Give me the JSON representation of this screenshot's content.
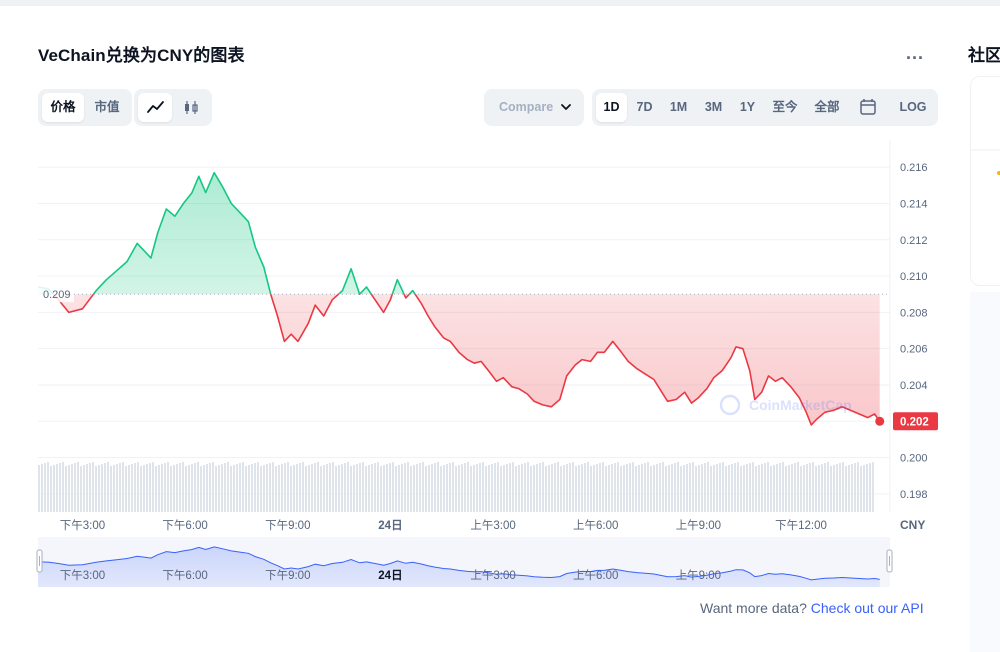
{
  "title": "VeChain兑换为CNY的图表",
  "more_label": "...",
  "side_title": "社区",
  "toggles": {
    "metric": [
      "价格",
      "市值"
    ],
    "chart_kinds": [
      "line-chart-icon",
      "candlestick-icon"
    ]
  },
  "compare_label": "Compare",
  "ranges": [
    "1D",
    "7D",
    "1M",
    "3M",
    "1Y",
    "至今",
    "全部"
  ],
  "calendar_icon": "calendar-icon",
  "log_label": "LOG",
  "colors": {
    "up": "#16c784",
    "down": "#ea3943",
    "brand": "#3861fb"
  },
  "watermark": "CoinMarketCap",
  "footer": {
    "text": "Want more data?",
    "link": "Check out our API"
  },
  "chart_data": {
    "type": "line",
    "currency": "CNY",
    "reference_value": 0.209,
    "reference_label": "0.209",
    "current_value": 0.202,
    "current_label": "0.202",
    "ylim": [
      0.197,
      0.2175
    ],
    "yticks": [
      "0.216",
      "0.214",
      "0.212",
      "0.210",
      "0.208",
      "0.206",
      "0.204",
      "0.202",
      "0.200",
      "0.198"
    ],
    "x_labels": [
      "下午3:00",
      "下午6:00",
      "下午9:00",
      "24日",
      "上午3:00",
      "上午6:00",
      "上午9:00",
      "下午12:00"
    ],
    "navigator_labels": [
      "下午3:00",
      "下午6:00",
      "下午9:00",
      "24日",
      "上午3:00",
      "上午6:00",
      "上午9:00"
    ],
    "xlim_hours": [
      13.7,
      36.6
    ],
    "series": [
      {
        "points": [
          [
            13.7,
            0.2094
          ],
          [
            14.0,
            0.2093
          ],
          [
            14.3,
            0.2087
          ],
          [
            14.6,
            0.208
          ],
          [
            15.0,
            0.2082
          ],
          [
            15.4,
            0.2092
          ],
          [
            15.7,
            0.2098
          ],
          [
            16.0,
            0.2103
          ],
          [
            16.3,
            0.2108
          ],
          [
            16.6,
            0.2118
          ],
          [
            16.8,
            0.2114
          ],
          [
            17.0,
            0.211
          ],
          [
            17.2,
            0.2124
          ],
          [
            17.45,
            0.2137
          ],
          [
            17.7,
            0.2133
          ],
          [
            17.95,
            0.214
          ],
          [
            18.2,
            0.2146
          ],
          [
            18.4,
            0.2155
          ],
          [
            18.6,
            0.2146
          ],
          [
            18.85,
            0.2157
          ],
          [
            19.1,
            0.2149
          ],
          [
            19.35,
            0.214
          ],
          [
            19.6,
            0.2135
          ],
          [
            19.85,
            0.213
          ],
          [
            20.05,
            0.2116
          ],
          [
            20.3,
            0.2105
          ],
          [
            20.5,
            0.209
          ],
          [
            20.7,
            0.2078
          ],
          [
            20.9,
            0.2064
          ],
          [
            21.1,
            0.2068
          ],
          [
            21.3,
            0.2064
          ],
          [
            21.6,
            0.2074
          ],
          [
            21.8,
            0.2084
          ],
          [
            22.05,
            0.2078
          ],
          [
            22.3,
            0.2087
          ],
          [
            22.6,
            0.2092
          ],
          [
            22.85,
            0.2104
          ],
          [
            23.1,
            0.209
          ],
          [
            23.3,
            0.2094
          ],
          [
            23.55,
            0.2087
          ],
          [
            23.8,
            0.208
          ],
          [
            24.0,
            0.2087
          ],
          [
            24.2,
            0.2098
          ],
          [
            24.45,
            0.2088
          ],
          [
            24.65,
            0.2092
          ],
          [
            24.9,
            0.2085
          ],
          [
            25.1,
            0.2078
          ],
          [
            25.3,
            0.2072
          ],
          [
            25.55,
            0.2066
          ],
          [
            25.75,
            0.2064
          ],
          [
            26.0,
            0.2058
          ],
          [
            26.25,
            0.2054
          ],
          [
            26.45,
            0.2052
          ],
          [
            26.65,
            0.2053
          ],
          [
            26.9,
            0.2047
          ],
          [
            27.1,
            0.2042
          ],
          [
            27.3,
            0.2044
          ],
          [
            27.55,
            0.2039
          ],
          [
            27.75,
            0.2038
          ],
          [
            28.0,
            0.2035
          ],
          [
            28.2,
            0.2031
          ],
          [
            28.45,
            0.2029
          ],
          [
            28.7,
            0.2028
          ],
          [
            28.95,
            0.2032
          ],
          [
            29.15,
            0.2045
          ],
          [
            29.4,
            0.2051
          ],
          [
            29.6,
            0.2054
          ],
          [
            29.85,
            0.2053
          ],
          [
            30.05,
            0.2058
          ],
          [
            30.25,
            0.2058
          ],
          [
            30.5,
            0.2064
          ],
          [
            30.75,
            0.2058
          ],
          [
            30.95,
            0.2053
          ],
          [
            31.2,
            0.2049
          ],
          [
            31.45,
            0.2046
          ],
          [
            31.7,
            0.2043
          ],
          [
            31.9,
            0.2037
          ],
          [
            32.1,
            0.2031
          ],
          [
            32.35,
            0.2032
          ],
          [
            32.6,
            0.2036
          ],
          [
            32.8,
            0.203
          ],
          [
            33.0,
            0.2033
          ],
          [
            33.25,
            0.2038
          ],
          [
            33.45,
            0.2044
          ],
          [
            33.7,
            0.2048
          ],
          [
            33.95,
            0.2055
          ],
          [
            34.1,
            0.2061
          ],
          [
            34.3,
            0.206
          ],
          [
            34.5,
            0.2048
          ],
          [
            34.65,
            0.2032
          ],
          [
            34.85,
            0.2036
          ],
          [
            35.05,
            0.2045
          ],
          [
            35.25,
            0.2042
          ],
          [
            35.45,
            0.2044
          ],
          [
            35.7,
            0.2039
          ],
          [
            35.95,
            0.2033
          ],
          [
            36.15,
            0.2025
          ],
          [
            36.3,
            0.2018
          ],
          [
            36.45,
            0.2021
          ],
          [
            36.7,
            0.2025
          ],
          [
            36.95,
            0.2026
          ],
          [
            37.2,
            0.2028
          ],
          [
            37.45,
            0.2026
          ],
          [
            37.7,
            0.2024
          ],
          [
            37.95,
            0.2022
          ],
          [
            38.15,
            0.2024
          ],
          [
            38.3,
            0.202
          ]
        ]
      }
    ],
    "volume": "present"
  }
}
